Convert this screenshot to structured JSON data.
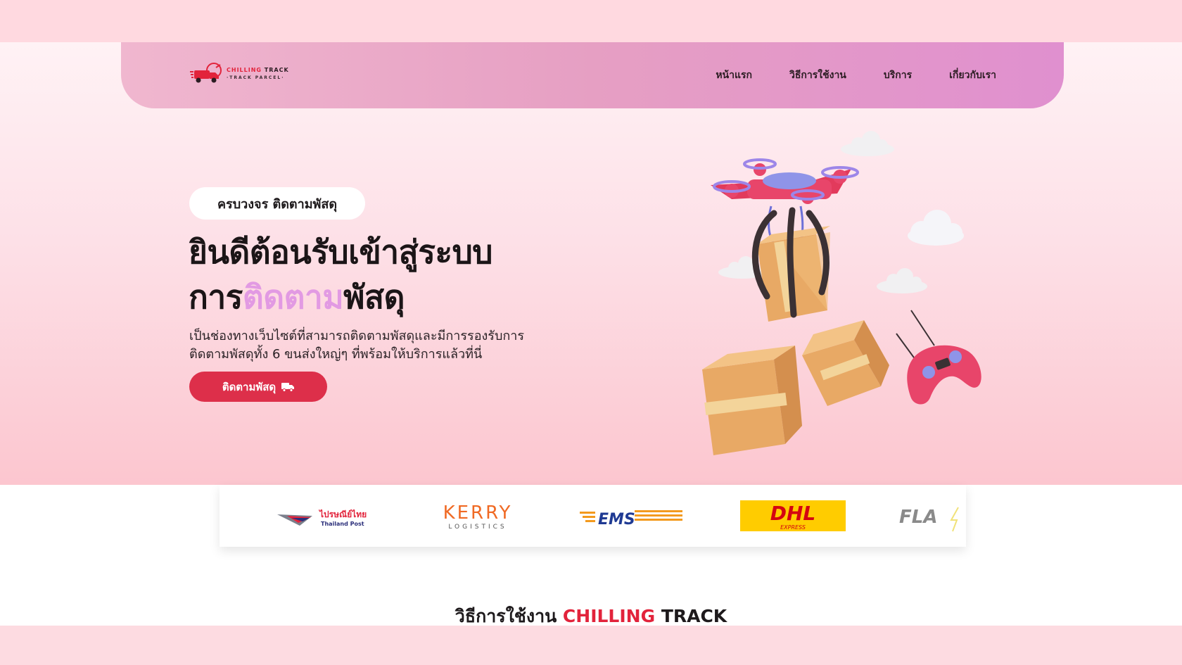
{
  "colors": {
    "accent_red": "#dd2f4a",
    "accent_pink": "#e29ae3",
    "nav_gradient_start": "#f0b7cf",
    "nav_gradient_end": "#e090cf",
    "hero_bg": "#fde0e7"
  },
  "brand": {
    "name_part1": "CHILLING",
    "name_part2": " TRACK",
    "tagline": "·TRACK PARCEL·"
  },
  "nav": {
    "items": [
      {
        "label": "หน้าแรก"
      },
      {
        "label": "วิธีการใช้งาน"
      },
      {
        "label": "บริการ"
      },
      {
        "label": "เกี่ยวกับเรา"
      }
    ]
  },
  "hero": {
    "badge": "ครบวงจร ติดตามพัสดุ",
    "title_line1": "ยินดีต้อนรับเข้าสู่ระบบ",
    "title_line2_prefix": "การ",
    "title_line2_highlight": "ติดตาม",
    "title_line2_suffix": "พัสดุ",
    "description_line1": "เป็นช่องทางเว็บไซต์ที่สามารถติดตามพัสดุและมีการรองรับการ",
    "description_line2": "ติดตามพัสดุทั้ง 6 ขนส่งใหญ่ๆ ที่พร้อมให้บริการแล้วที่นี่",
    "cta_label": "ติดตามพัสดุ",
    "cta_icon": "truck-icon"
  },
  "carriers": [
    {
      "name": "thailand-post",
      "text_th": "ไปรษณีย์ไทย",
      "text_en": "Thailand Post"
    },
    {
      "name": "kerry",
      "text": "KERRY",
      "sub": "LOGISTICS"
    },
    {
      "name": "ems",
      "text": "EMS"
    },
    {
      "name": "dhl",
      "text": "DHL",
      "sub": "EXPRESS"
    },
    {
      "name": "flash",
      "text": "FLA"
    }
  ],
  "section": {
    "title_prefix": "วิธีการใช้งาน ",
    "title_red": "CHILLING",
    "title_suffix": " TRACK"
  }
}
